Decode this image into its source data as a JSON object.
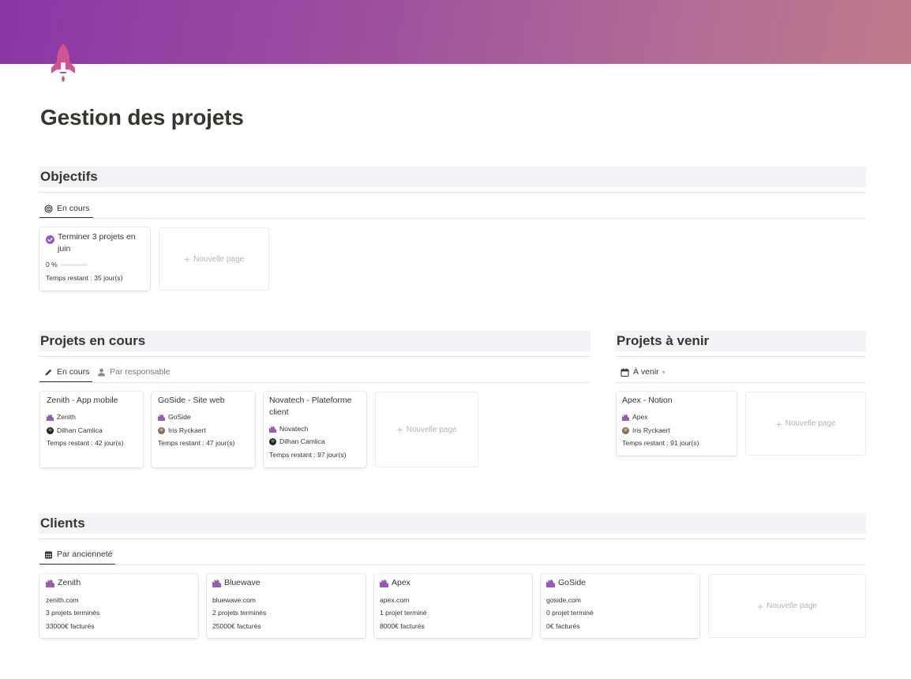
{
  "page": {
    "title": "Gestion des projets"
  },
  "colors": {
    "accent": "#9b59b6",
    "cover_start": "#8a37a6",
    "cover_end": "#bf7a8a",
    "section_bg": "#f4f2f7"
  },
  "objectifs": {
    "heading": "Objectifs",
    "tab": "En cours",
    "card": {
      "title_line1": "Terminer 3 projets en",
      "title_line2": "juin",
      "progress_label": "0 %",
      "progress": 0,
      "remaining": "Temps restant : 35 jour(s)"
    },
    "new_page": "Nouvelle page"
  },
  "projets_en_cours": {
    "heading": "Projets en cours",
    "tabs": [
      "En cours",
      "Par responsable"
    ],
    "cards": [
      {
        "title_line1": "Zenith - App mobile",
        "title_line2": "",
        "client": "Zenith",
        "owner": "Dilhan Camlica",
        "remaining": "Temps restant : 42 jour(s)"
      },
      {
        "title_line1": "GoSide - Site web",
        "title_line2": "",
        "client": "GoSide",
        "owner": "Iris Ryckaert",
        "remaining": "Temps restant : 47 jour(s)"
      },
      {
        "title_line1": "Novatech - Plateforme",
        "title_line2": "client",
        "client": "Novatech",
        "owner": "Dilhan Camlica",
        "remaining": "Temps restant : 97 jour(s)"
      }
    ],
    "new_page": "Nouvelle page"
  },
  "projets_a_venir": {
    "heading": "Projets à venir",
    "tab": "À venir",
    "card": {
      "title": "Apex - Notion",
      "client": "Apex",
      "owner": "Iris Ryckaert",
      "remaining": "Temps restant : 91 jour(s)"
    },
    "new_page": "Nouvelle page"
  },
  "clients": {
    "heading": "Clients",
    "tab": "Par ancienneté",
    "cards": [
      {
        "name": "Zenith",
        "site": "zenith.com",
        "projects": "3 projets terminés",
        "billed": "33000€ facturés"
      },
      {
        "name": "Bluewave",
        "site": "bluewave.com",
        "projects": "2 projets terminés",
        "billed": "25000€ facturés"
      },
      {
        "name": "Apex",
        "site": "apex.com",
        "projects": "1 projet terminé",
        "billed": "8000€ facturés"
      },
      {
        "name": "GoSide",
        "site": "goside.com",
        "projects": "0 projet terminé",
        "billed": "0€ facturés"
      }
    ],
    "new_page": "Nouvelle page"
  },
  "icons": {
    "page": "rocket-icon",
    "objective_tab": "target-icon",
    "objective_done": "check-circle-icon",
    "projects_tab": "pencil-icon",
    "owner_tab": "person-icon",
    "upcoming_tab": "calendar-icon",
    "clients_tab": "calendar-grid-icon",
    "client": "buildings-icon"
  }
}
